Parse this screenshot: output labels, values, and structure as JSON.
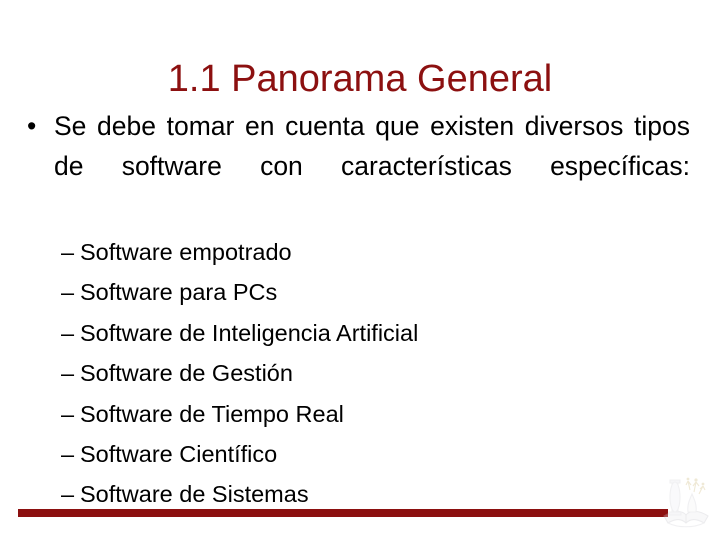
{
  "slide": {
    "title": "1.1 Panorama General",
    "title_color": "#8c1010",
    "background_color": "#ffffff",
    "body_text_color": "#000000"
  },
  "body": {
    "level1": [
      {
        "bullet_glyph": "•",
        "text": "Se debe tomar en cuenta que existen diversos tipos de software con características específicas:"
      }
    ],
    "level2": {
      "dash_glyph": "–",
      "items": [
        {
          "text": "Software empotrado"
        },
        {
          "text": "Software para PCs"
        },
        {
          "text": "Software de Inteligencia Artificial"
        },
        {
          "text": "Software de Gestión"
        },
        {
          "text": "Software de Tiempo Real"
        },
        {
          "text": "Software Científico"
        },
        {
          "text": "Software de Sistemas"
        }
      ]
    }
  },
  "footer": {
    "rule_color": "#8c1010",
    "emblem_name": "institution-crest-watermark"
  }
}
